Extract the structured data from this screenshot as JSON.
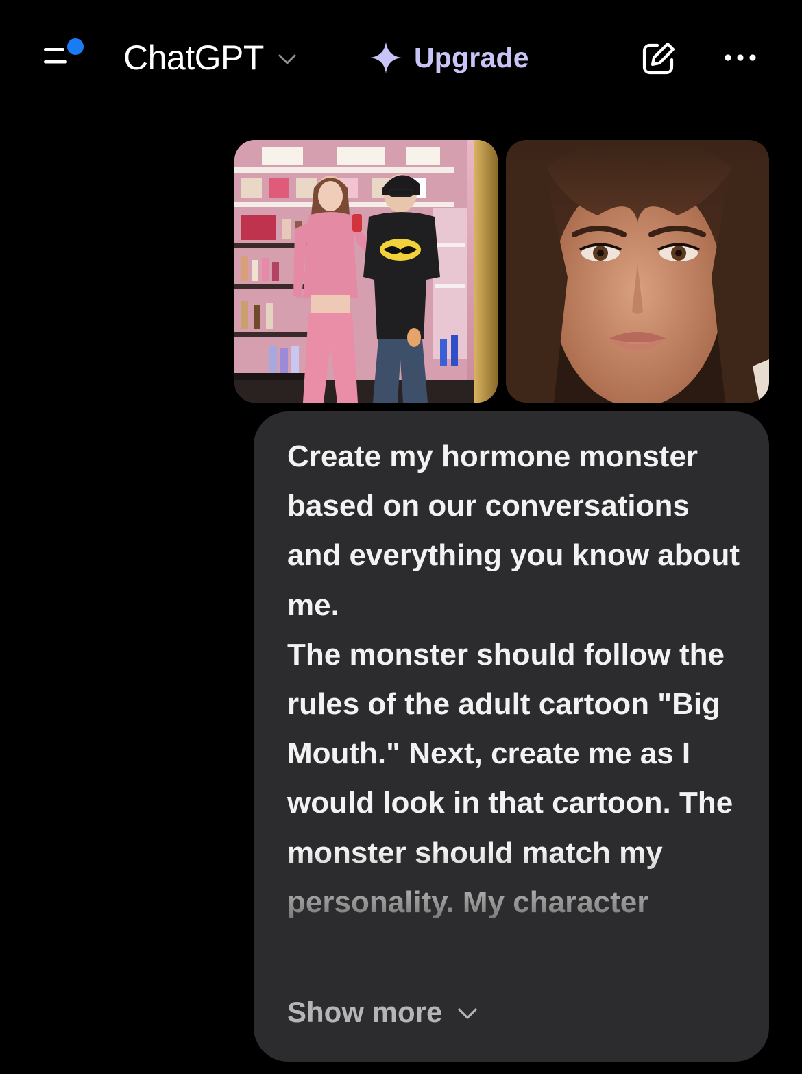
{
  "header": {
    "title": "ChatGPT",
    "upgrade_label": "Upgrade"
  },
  "icons": {
    "menu": "sidebar-menu-icon",
    "notification_dot_color": "#1a7cf5",
    "title_chevron": "chevron-down-icon",
    "upgrade": "sparkle-icon",
    "compose": "new-chat-icon",
    "more": "more-horizontal-icon"
  },
  "colors": {
    "background": "#000000",
    "bubble": "#2c2c2e",
    "upgrade_text": "#c9c4f6",
    "message_text": "#f2f2f2",
    "show_more_text": "#b5b5b8"
  },
  "attachments": [
    {
      "type": "image",
      "description": "mirror-photo"
    },
    {
      "type": "image",
      "description": "portrait-photo"
    }
  ],
  "message": {
    "text": "Create my hormone monster based on our conversations and everything you know about me.\nThe monster should follow the rules of the adult cartoon \"Big Mouth.\" Next, create me as I would look in that cartoon. The monster should match my personality. My character",
    "show_more_label": "Show more"
  }
}
